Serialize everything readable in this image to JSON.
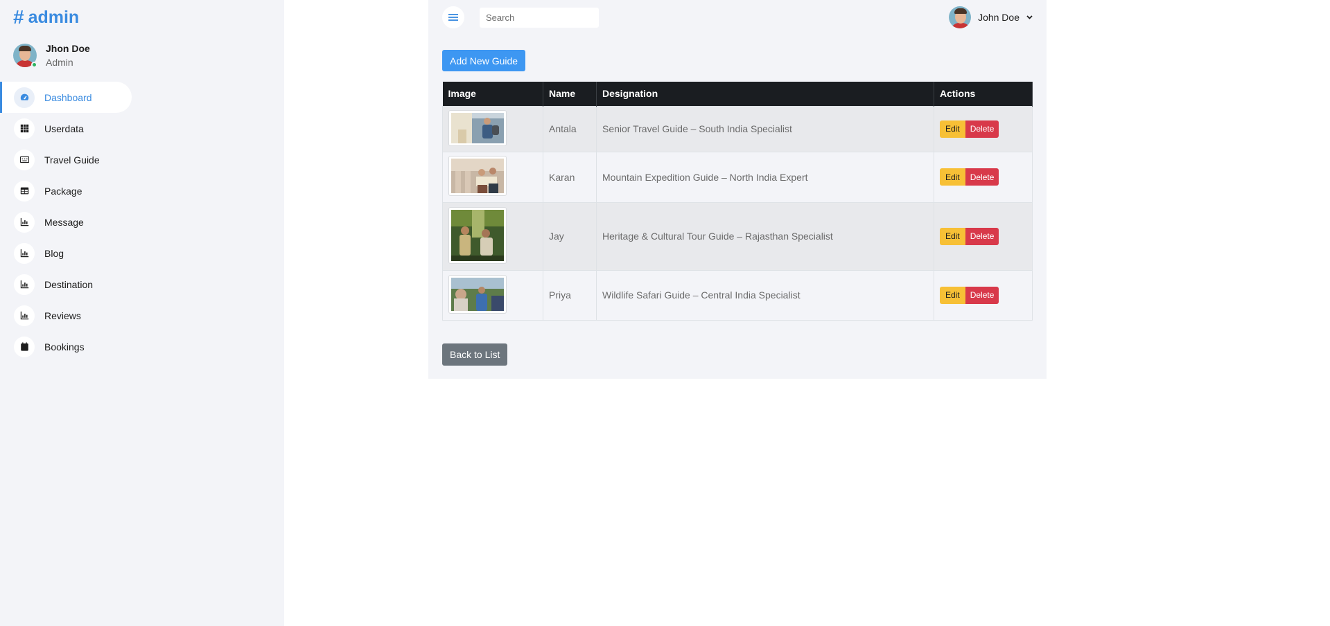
{
  "brand": {
    "symbol": "#",
    "name": "admin"
  },
  "profile": {
    "name": "Jhon Doe",
    "role": "Admin"
  },
  "sidebar": {
    "items": [
      {
        "label": "Dashboard",
        "icon": "speedometer-icon",
        "active": true
      },
      {
        "label": "Userdata",
        "icon": "grid-icon"
      },
      {
        "label": "Travel Guide",
        "icon": "keyboard-icon"
      },
      {
        "label": "Package",
        "icon": "table-icon"
      },
      {
        "label": "Message",
        "icon": "bar-chart-icon"
      },
      {
        "label": "Blog",
        "icon": "bar-chart-icon"
      },
      {
        "label": "Destination",
        "icon": "bar-chart-icon"
      },
      {
        "label": "Reviews",
        "icon": "bar-chart-icon"
      },
      {
        "label": "Bookings",
        "icon": "calendar-icon"
      }
    ]
  },
  "topbar": {
    "search_placeholder": "Search",
    "user_name": "John Doe"
  },
  "actions": {
    "add_label": "Add New Guide",
    "back_label": "Back to List"
  },
  "table": {
    "headers": [
      "Image",
      "Name",
      "Designation",
      "Actions"
    ],
    "rows": [
      {
        "name": "Antala",
        "designation": "Senior Travel Guide – South India Specialist"
      },
      {
        "name": "Karan",
        "designation": "Mountain Expedition Guide – North India Expert"
      },
      {
        "name": "Jay",
        "designation": "Heritage & Cultural Tour Guide – Rajasthan Specialist"
      },
      {
        "name": "Priya",
        "designation": "Wildlife Safari Guide – Central India Specialist"
      }
    ],
    "edit_label": "Edit",
    "delete_label": "Delete"
  },
  "colors": {
    "accent": "#3a8be0",
    "primary_button": "#3d97f2",
    "edit": "#f7c036",
    "delete": "#d8394a",
    "secondary": "#6c757d",
    "header": "#1a1d21"
  }
}
